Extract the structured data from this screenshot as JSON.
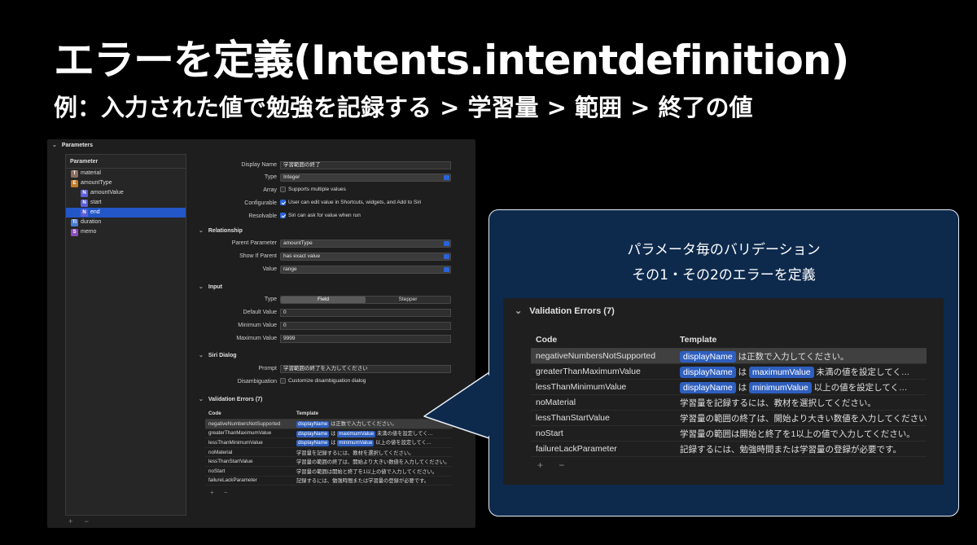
{
  "slide": {
    "title": "エラーを定義(Intents.intentdefinition)",
    "subtitle": "例：入力された値で勉強を記録する > 学習量 > 範囲 > 終了の値"
  },
  "xcode": {
    "section_parameters": "Parameters",
    "param_list_header": "Parameter",
    "params": [
      {
        "badge": "T",
        "label": "material",
        "indent": 0,
        "selected": false
      },
      {
        "badge": "E",
        "label": "amountType",
        "indent": 0,
        "selected": false
      },
      {
        "badge": "N",
        "label": "amountValue",
        "indent": 1,
        "selected": false
      },
      {
        "badge": "N",
        "label": "start",
        "indent": 1,
        "selected": false
      },
      {
        "badge": "N",
        "label": "end",
        "indent": 1,
        "selected": true
      },
      {
        "badge": "Ti",
        "label": "duration",
        "indent": 0,
        "selected": false
      },
      {
        "badge": "S",
        "label": "memo",
        "indent": 0,
        "selected": false
      }
    ],
    "list_add_remove": "+ −",
    "display_name_label": "Display Name",
    "display_name_value": "学習範囲の終了",
    "type_label": "Type",
    "type_value": "Integer",
    "array_label": "Array",
    "array_value": "Supports multiple values",
    "configurable_label": "Configurable",
    "configurable_value": "User can edit value in Shortcuts, widgets, and Add to Siri",
    "resolvable_label": "Resolvable",
    "resolvable_value": "Siri can ask for value when run",
    "relationship_section": "Relationship",
    "parent_param_label": "Parent Parameter",
    "parent_param_value": "amountType",
    "show_if_label": "Show If Parent",
    "show_if_value": "has exact value",
    "value_label": "Value",
    "value_value": "range",
    "input_section": "Input",
    "input_type_label": "Type",
    "seg_field": "Field",
    "seg_stepper": "Stepper",
    "default_label": "Default Value",
    "default_value": "0",
    "min_label": "Minimum Value",
    "min_value": "0",
    "max_label": "Maximum Value",
    "max_value": "9999",
    "siri_section": "Siri Dialog",
    "prompt_label": "Prompt",
    "prompt_value": "学習範囲の終了を入力してください",
    "disambig_label": "Disambiguation",
    "disambig_value": "Customize disambiguation dialog",
    "ve_section": "Validation Errors (7)",
    "ve_col_code": "Code",
    "ve_col_template": "Template",
    "ve_add_remove": "+ −"
  },
  "validation_errors": [
    {
      "code": "negativeNumbersNotSupported",
      "parts": [
        {
          "tok": "displayName"
        },
        {
          "text": " は正数で入力してください。"
        }
      ],
      "selected": true
    },
    {
      "code": "greaterThanMaximumValue",
      "parts": [
        {
          "tok": "displayName"
        },
        {
          "text": " は "
        },
        {
          "tok": "maximumValue"
        },
        {
          "text": " 未満の値を設定してく…"
        }
      ],
      "selected": false
    },
    {
      "code": "lessThanMinimumValue",
      "parts": [
        {
          "tok": "displayName"
        },
        {
          "text": " は "
        },
        {
          "tok": "minimumValue"
        },
        {
          "text": " 以上の値を設定してく…"
        }
      ],
      "selected": false
    },
    {
      "code": "noMaterial",
      "parts": [
        {
          "text": "学習量を記録するには、教材を選択してください。"
        }
      ],
      "selected": false
    },
    {
      "code": "lessThanStartValue",
      "parts": [
        {
          "text": "学習量の範囲の終了は、開始より大きい数値を入力してください。"
        }
      ],
      "selected": false
    },
    {
      "code": "noStart",
      "parts": [
        {
          "text": "学習量の範囲は開始と終了を1以上の値で入力してください。"
        }
      ],
      "selected": false
    },
    {
      "code": "failureLackParameter",
      "parts": [
        {
          "text": "記録するには、勉強時間または学習量の登録が必要です。"
        }
      ],
      "selected": false
    }
  ],
  "callout": {
    "line1": "パラメータ毎のバリデーション",
    "line2": "その1・その2のエラーを定義",
    "zoom_section": "Validation Errors (7)",
    "col_code": "Code",
    "col_template": "Template",
    "add_remove": "+ −"
  },
  "colors": {
    "accent": "#2a64d8",
    "token": "#2e5fbf",
    "callout_bg": "#0d2a4d"
  }
}
